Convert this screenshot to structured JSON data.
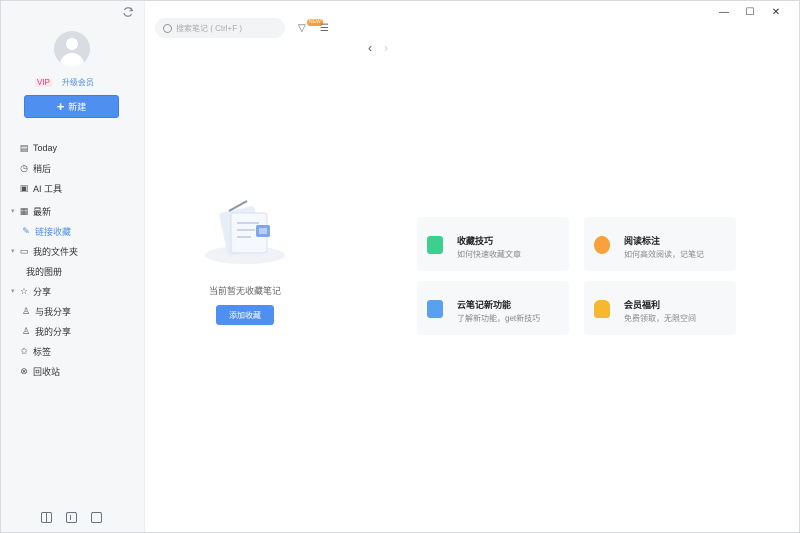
{
  "sidebar": {
    "user": {
      "vip_label": "VIP",
      "upgrade_label": "升级会员"
    },
    "new_button_label": "新建",
    "items": [
      {
        "label": "Today",
        "icon": "calendar-icon"
      },
      {
        "label": "稍后",
        "icon": "clock-icon"
      },
      {
        "label": "AI 工具",
        "icon": "ai-icon"
      },
      {
        "label": "最新",
        "icon": "folder-icon"
      },
      {
        "label": "链接收藏",
        "icon": "link-icon"
      },
      {
        "label": "我的文件夹",
        "icon": "folder-icon"
      },
      {
        "label": "我的图册",
        "icon": ""
      },
      {
        "label": "分享",
        "icon": "share-icon"
      },
      {
        "label": "与我分享",
        "icon": "people-icon"
      },
      {
        "label": "我的分享",
        "icon": "people-icon"
      },
      {
        "label": "标签",
        "icon": "tag-icon"
      },
      {
        "label": "回收站",
        "icon": "trash-icon"
      }
    ]
  },
  "topbar": {
    "search_placeholder": "搜索笔记 ( Ctrl+F )",
    "new_badge": "NEW"
  },
  "empty_state": {
    "text": "当前暂无收藏笔记",
    "button_label": "添加收藏"
  },
  "cards": [
    {
      "title": "收藏技巧",
      "desc": "如何快速收藏文章",
      "color": "#3ecf8e"
    },
    {
      "title": "阅读标注",
      "desc": "如何高效阅读，记笔记",
      "color": "#f7a23b"
    },
    {
      "title": "云笔记新功能",
      "desc": "了解新功能，get新技巧",
      "color": "#5aa0f0"
    },
    {
      "title": "会员福利",
      "desc": "免费领取，无限空间",
      "color": "#f5b82e"
    }
  ]
}
